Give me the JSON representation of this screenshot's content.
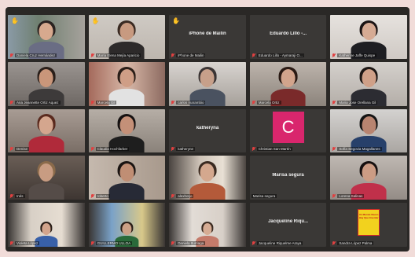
{
  "colors": {
    "background": "#f1dcd9",
    "frame": "#2a2826",
    "tile_empty": "#3a3836",
    "active_speaker": "#c8d23c",
    "mic_muted": "#e04040",
    "avatar_c": "#d9266d",
    "raised_hand": "#f5c518"
  },
  "participants": [
    {
      "name": "Daniela Cruz Hernández",
      "video": true,
      "active": true,
      "hand": true
    },
    {
      "name": "María Elena Mejía Aparicio",
      "video": true,
      "hand": true
    },
    {
      "name": "iPhone de Mailin",
      "video": false,
      "center": "iPhone de Mailin",
      "hand": true
    },
    {
      "name": "Eduardo Lillo - Aymaraji O...",
      "video": false,
      "center": "Eduardo Lillo -..."
    },
    {
      "name": "Katherine Jaffe Quispe",
      "video": true
    },
    {
      "name": "Ana Jeannette Ortiz Aquez",
      "video": true
    },
    {
      "name": "Marcela Gil",
      "video": true
    },
    {
      "name": "carlos marambio",
      "video": true
    },
    {
      "name": "Marcela Ortiz",
      "video": true
    },
    {
      "name": "Maria Jose Orellana Gil",
      "video": true
    },
    {
      "name": "Denise",
      "video": true
    },
    {
      "name": "Claudia Hochfarber",
      "video": true
    },
    {
      "name": "katheryne",
      "video": false,
      "center": "katheryna"
    },
    {
      "name": "Christian San Martín",
      "video": false,
      "avatar": "C"
    },
    {
      "name": "Sofía Segovia Magallanes",
      "video": true
    },
    {
      "name": "Inés",
      "video": true
    },
    {
      "name": "roberto",
      "video": true
    },
    {
      "name": "alexhorjo",
      "video": true
    },
    {
      "name": "Marisa segura",
      "video": false,
      "center": "Marisa segura"
    },
    {
      "name": "Lorena Salinas",
      "video": true
    },
    {
      "name": "Violeta López",
      "video": true
    },
    {
      "name": "GUILLERMO ULLOA",
      "video": true
    },
    {
      "name": "Daniela Iturriaga",
      "video": true
    },
    {
      "name": "Jacqueline Riquelme Araya",
      "video": false,
      "center": "Jacqueline Riqu..."
    },
    {
      "name": "Sandra López Palma",
      "video": true,
      "book": "Un Mundo Nuevo Hay Que Inventar"
    }
  ]
}
